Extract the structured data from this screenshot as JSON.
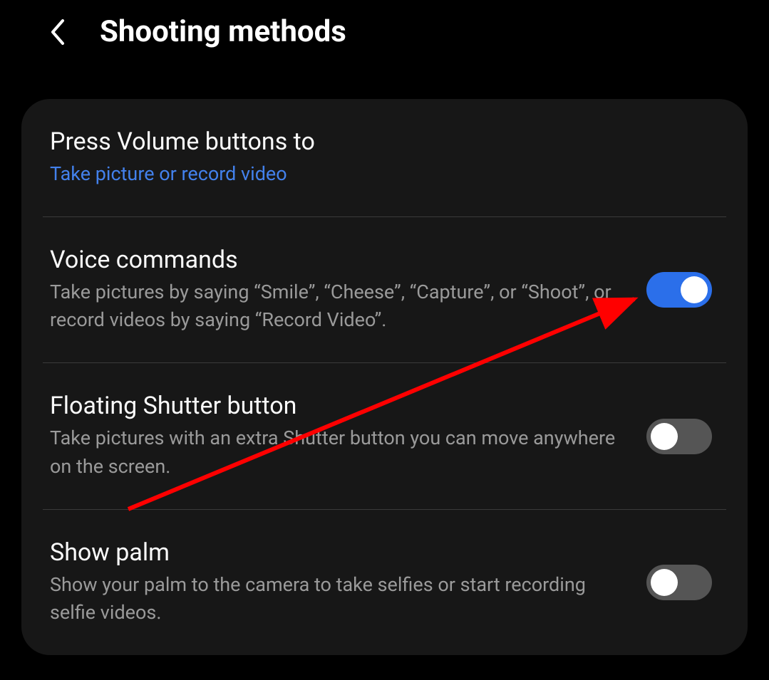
{
  "header": {
    "title": "Shooting methods"
  },
  "settings": [
    {
      "title": "Press Volume buttons to",
      "subtitle": "Take picture or record video",
      "subtitle_accent": true,
      "has_toggle": false
    },
    {
      "title": "Voice commands",
      "subtitle": "Take pictures by saying “Smile”, “Cheese”, “Capture”, or “Shoot”, or record videos by saying “Record Video”.",
      "subtitle_accent": false,
      "has_toggle": true,
      "toggle_on": true
    },
    {
      "title": "Floating Shutter button",
      "subtitle": "Take pictures with an extra Shutter button you can move anywhere on the screen.",
      "subtitle_accent": false,
      "has_toggle": true,
      "toggle_on": false
    },
    {
      "title": "Show palm",
      "subtitle": "Show your palm to the camera to take selfies or start recording selfie videos.",
      "subtitle_accent": false,
      "has_toggle": true,
      "toggle_on": false
    }
  ],
  "annotation": {
    "arrow_color": "#ff0000"
  }
}
